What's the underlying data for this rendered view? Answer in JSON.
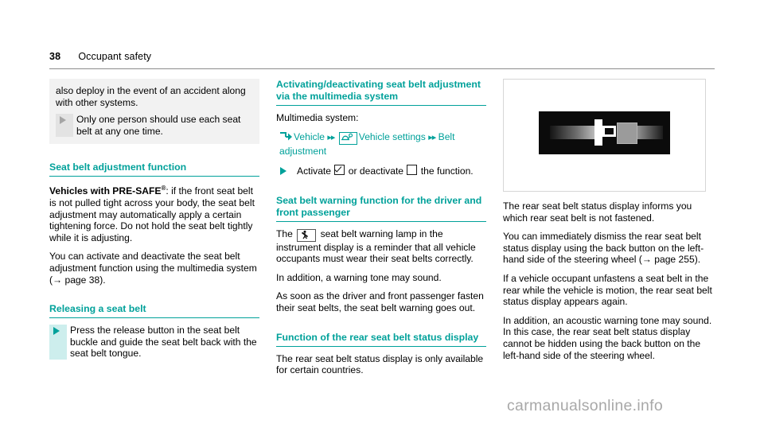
{
  "header": {
    "page_number": "38",
    "chapter": "Occupant safety"
  },
  "left_column": {
    "warning_box": {
      "paragraph": "also deploy in the event of an accident along with other systems.",
      "step": "Only one person should use each seat belt at any one time."
    },
    "section_1": {
      "heading": "Seat belt adjustment function",
      "paragraph_1_bold": "Vehicles with PRE-SAFE",
      "paragraph_1_sup": "®",
      "paragraph_1_rest": ": if the front seat belt is not pulled tight across your body, the seat belt adjustment may automatically apply a certain tightening force. Do not hold the seat belt tightly while it is adjusting.",
      "paragraph_2": "You can activate and deactivate the seat belt adjustment function using the multimedia system (→ page 38)."
    },
    "section_2": {
      "heading": "Releasing a seat belt",
      "step": "Press the release button in the seat belt buckle and guide the seat belt back with the seat belt tongue."
    }
  },
  "middle_column": {
    "section_1": {
      "heading": "Activating/deactivating seat belt adjustment via the multimedia system",
      "intro": "Multimedia system:",
      "path": {
        "turn_icon": "turn-arrow-icon",
        "item_1": "Vehicle",
        "separator_1": "▸▸",
        "settings_icon": "vehicle-settings-icon",
        "item_2": "Vehicle settings",
        "separator_2": "▸▸",
        "item_3": "Belt adjustment"
      },
      "step_prefix": "Activate",
      "step_middle": "or deactivate",
      "step_suffix": "the function."
    },
    "section_2": {
      "heading": "Seat belt warning function for the driver and front passenger",
      "paragraph_1_before": "The",
      "lamp_icon": "seat-belt-warning-lamp-icon",
      "paragraph_1_after": "seat belt warning lamp in the instrument display is a reminder that all vehicle occupants must wear their seat belts correctly.",
      "paragraph_2": "In addition, a warning tone may sound.",
      "paragraph_3": "As soon as the driver and front passenger fasten their seat belts, the seat belt warning goes out."
    },
    "section_3": {
      "heading": "Function of the rear seat belt status display",
      "paragraph_1": "The rear seat belt status display is only available for certain countries."
    }
  },
  "right_column": {
    "figure": {
      "alt": "rear-seat-belt-status-display-illustration"
    },
    "paragraph_1": "The rear seat belt status display informs you which rear seat belt is not fastened.",
    "paragraph_2": "You can immediately dismiss the rear seat belt status display using the back button on the left-hand side of the steering wheel (→ page 255).",
    "paragraph_3": "If a vehicle occupant unfastens a seat belt in the rear while the vehicle is motion, the rear seat belt status display appears again.",
    "paragraph_4": "In addition, an acoustic warning tone may sound. In this case, the rear seat belt status display cannot be hidden using the back button on the left-hand side of the steering wheel."
  },
  "watermark": "carmanualsonline.info",
  "colors": {
    "accent_teal": "#00a19a",
    "bullet_bar_teal": "#cdeeed",
    "grey_box": "#f2f2f2"
  }
}
